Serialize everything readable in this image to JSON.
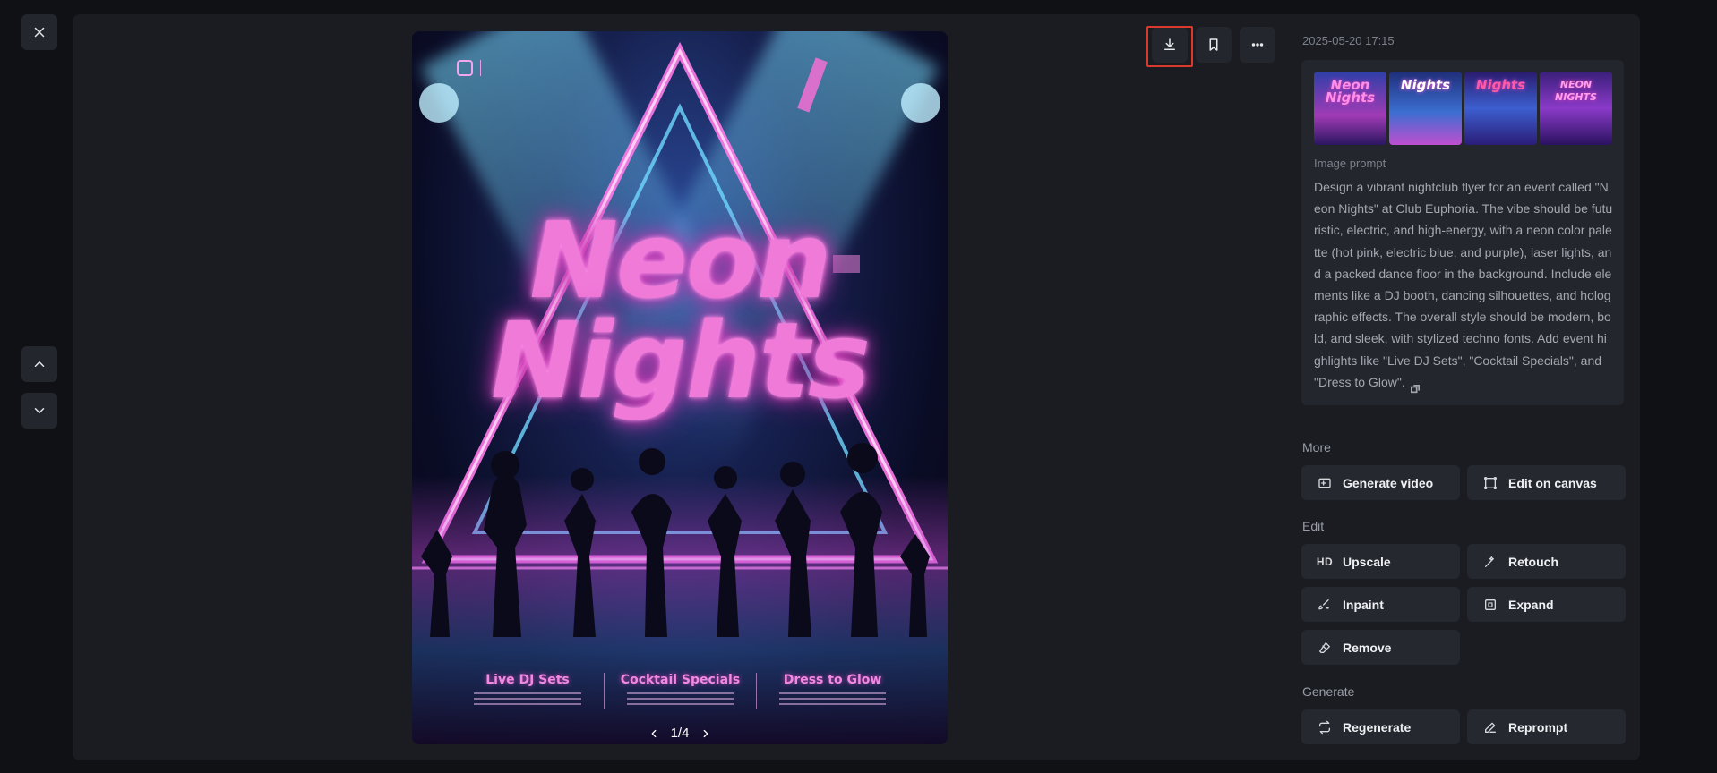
{
  "viewer": {
    "close_icon": "close-icon",
    "nav_up_icon": "chevron-up-icon",
    "nav_down_icon": "chevron-down-icon"
  },
  "toolbar": {
    "download_icon": "download-icon",
    "bookmark_icon": "bookmark-icon",
    "more_icon": "more-horizontal-icon"
  },
  "poster": {
    "title_line1": "Neon",
    "title_line2": "Nights",
    "highlights": [
      "Live DJ Sets",
      "Cocktail Specials",
      "Dress to Glow"
    ],
    "pager": "1/4"
  },
  "details": {
    "timestamp": "2025-05-20 17:15",
    "thumbnails": [
      {
        "label": "Neon Nights"
      },
      {
        "label": "Nights"
      },
      {
        "label": "Nights"
      },
      {
        "label": "NEON NIGHTS"
      }
    ],
    "prompt_label": "Image prompt",
    "prompt_text": "Design a vibrant nightclub flyer for an event called \"Neon Nights\" at Club Euphoria. The vibe should be futuristic, electric, and high-energy, with a neon color palette (hot pink, electric blue, and purple), laser lights, and a packed dance floor in the background. Include elements like a DJ booth, dancing silhouettes, and holographic effects. The overall style should be modern, bold, and sleek, with stylized techno fonts. Add event highlights like \"Live DJ Sets\", \"Cocktail Specials\", and \"Dress to Glow\"."
  },
  "sections": {
    "more": {
      "label": "More",
      "buttons": [
        {
          "label": "Generate video",
          "icon": "video-plus-icon"
        },
        {
          "label": "Edit on canvas",
          "icon": "canvas-icon"
        }
      ]
    },
    "edit": {
      "label": "Edit",
      "buttons": [
        {
          "label": "Upscale",
          "icon": "hd-icon",
          "icon_text": "HD"
        },
        {
          "label": "Retouch",
          "icon": "magic-wand-icon"
        },
        {
          "label": "Inpaint",
          "icon": "inpaint-brush-icon"
        },
        {
          "label": "Expand",
          "icon": "expand-icon"
        },
        {
          "label": "Remove",
          "icon": "eraser-icon"
        }
      ]
    },
    "generate": {
      "label": "Generate",
      "buttons": [
        {
          "label": "Regenerate",
          "icon": "repeat-icon"
        },
        {
          "label": "Reprompt",
          "icon": "pencil-icon"
        }
      ]
    }
  },
  "colors": {
    "background": "#0f1115",
    "panel": "#1a1c21",
    "button": "#25282f",
    "highlight_box": "#d93a2b",
    "neon_pink": "#f07ad8"
  }
}
